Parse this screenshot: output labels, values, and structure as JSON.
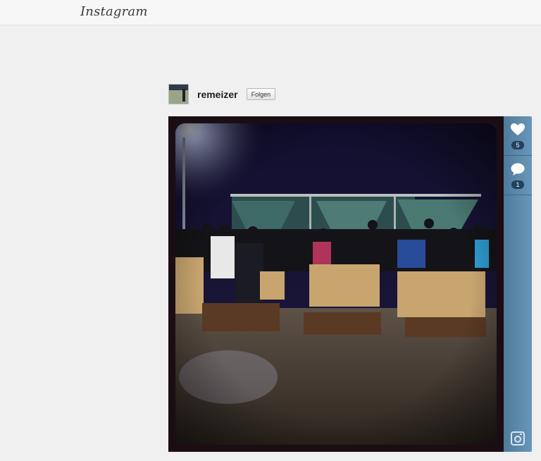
{
  "header": {
    "logo_text": "Instagram"
  },
  "post": {
    "username": "remeizer",
    "follow_label": "Folgen",
    "likes_count": "5",
    "comments_count": "1"
  },
  "icons": {
    "like": "heart-icon",
    "comment": "speech-bubble-icon",
    "camera": "camera-icon"
  },
  "colors": {
    "panel_accent": "#5d89ad",
    "count_badge": "#20415d"
  }
}
